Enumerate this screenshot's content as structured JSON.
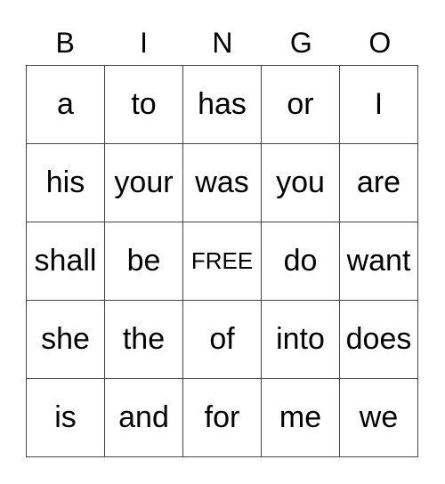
{
  "header": [
    "B",
    "I",
    "N",
    "G",
    "O"
  ],
  "rows": [
    [
      "a",
      "to",
      "has",
      "or",
      "I"
    ],
    [
      "his",
      "your",
      "was",
      "you",
      "are"
    ],
    [
      "shall",
      "be",
      "FREE",
      "do",
      "want"
    ],
    [
      "she",
      "the",
      "of",
      "into",
      "does"
    ],
    [
      "is",
      "and",
      "for",
      "me",
      "we"
    ]
  ]
}
